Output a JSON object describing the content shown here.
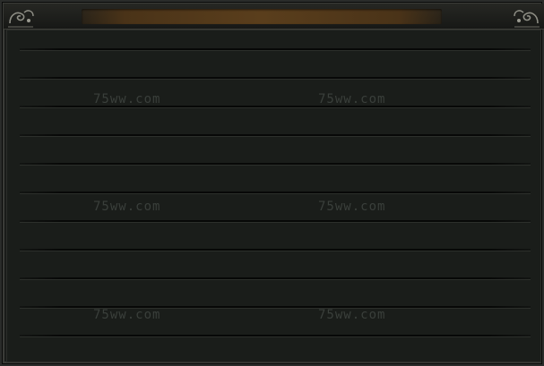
{
  "window": {
    "title": ""
  },
  "list": {
    "row_count": 11
  },
  "watermarks": [
    "75ww.com",
    "75ww.com",
    "75ww.com",
    "75ww.com",
    "75ww.com",
    "75ww.com"
  ]
}
